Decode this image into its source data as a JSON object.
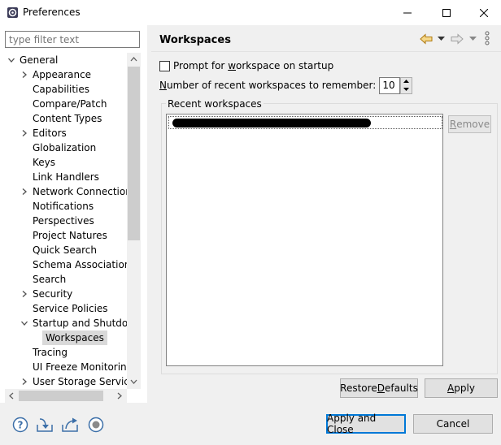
{
  "window": {
    "title": "Preferences",
    "icon": "eclipse-preferences-icon"
  },
  "sidebar": {
    "filter_placeholder": "type filter text",
    "items": [
      {
        "label": "General",
        "level": 0,
        "toggle": "expanded"
      },
      {
        "label": "Appearance",
        "level": 1,
        "toggle": "collapsed"
      },
      {
        "label": "Capabilities",
        "level": 1,
        "toggle": "none"
      },
      {
        "label": "Compare/Patch",
        "level": 1,
        "toggle": "none"
      },
      {
        "label": "Content Types",
        "level": 1,
        "toggle": "none"
      },
      {
        "label": "Editors",
        "level": 1,
        "toggle": "collapsed"
      },
      {
        "label": "Globalization",
        "level": 1,
        "toggle": "none"
      },
      {
        "label": "Keys",
        "level": 1,
        "toggle": "none"
      },
      {
        "label": "Link Handlers",
        "level": 1,
        "toggle": "none"
      },
      {
        "label": "Network Connection",
        "level": 1,
        "toggle": "collapsed"
      },
      {
        "label": "Notifications",
        "level": 1,
        "toggle": "none"
      },
      {
        "label": "Perspectives",
        "level": 1,
        "toggle": "none"
      },
      {
        "label": "Project Natures",
        "level": 1,
        "toggle": "none"
      },
      {
        "label": "Quick Search",
        "level": 1,
        "toggle": "none"
      },
      {
        "label": "Schema Associations",
        "level": 1,
        "toggle": "none"
      },
      {
        "label": "Search",
        "level": 1,
        "toggle": "none"
      },
      {
        "label": "Security",
        "level": 1,
        "toggle": "collapsed"
      },
      {
        "label": "Service Policies",
        "level": 1,
        "toggle": "none"
      },
      {
        "label": "Startup and Shutdow",
        "level": 1,
        "toggle": "expanded"
      },
      {
        "label": "Workspaces",
        "level": 2,
        "toggle": "none",
        "selected": true
      },
      {
        "label": "Tracing",
        "level": 1,
        "toggle": "none"
      },
      {
        "label": "UI Freeze Monitoring",
        "level": 1,
        "toggle": "none"
      },
      {
        "label": "User Storage Service",
        "level": 1,
        "toggle": "collapsed"
      }
    ]
  },
  "page": {
    "title": "Workspaces",
    "prompt_checkbox": {
      "label_pre": "Prompt for ",
      "label_mnemonic": "w",
      "label_post": "orkspace on startup",
      "checked": false
    },
    "recent_count": {
      "label_mnemonic": "N",
      "label_post": "umber of recent workspaces to remember:",
      "value": "10"
    },
    "recent_group_label": "Recent workspaces",
    "remove_button": {
      "mnemonic": "R",
      "rest": "emove"
    },
    "restore_defaults": {
      "pre": "Restore ",
      "mnemonic": "D",
      "post": "efaults"
    },
    "apply": {
      "mnemonic": "A",
      "rest": "pply"
    }
  },
  "footer": {
    "apply_and_close": "Apply and Close",
    "cancel": "Cancel",
    "icons": [
      "help-icon",
      "import-icon",
      "export-icon",
      "record-icon"
    ]
  }
}
